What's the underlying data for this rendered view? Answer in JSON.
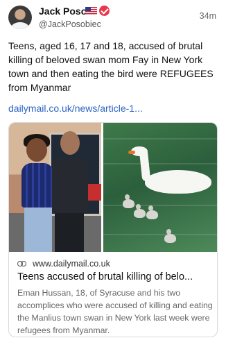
{
  "post": {
    "author_name": "Jack Poso",
    "author_flag": "us-flag",
    "verified_badge": "verified-icon",
    "handle": "@JackPosobiec",
    "timestamp": "34m",
    "text": "Teens, aged 16, 17 and 18, accused of brutal killing of beloved swan mom Fay in New York town and then eating the bird were REFUGEES from Myanmar",
    "link_text": "dailymail.co.uk/news/article-1..."
  },
  "card": {
    "domain": "www.dailymail.co.uk",
    "domain_icon": "link-icon",
    "title": "Teens accused of brutal killing of belo...",
    "description": "Eman Hussan, 18, of Syracuse and his two accomplices who were accused of killing and eating the Manlius town swan in New York last week were refugees from Myanmar."
  },
  "colors": {
    "link": "#2b63c6",
    "verified": "#e8384f",
    "text": "#111111",
    "muted": "#666666"
  }
}
